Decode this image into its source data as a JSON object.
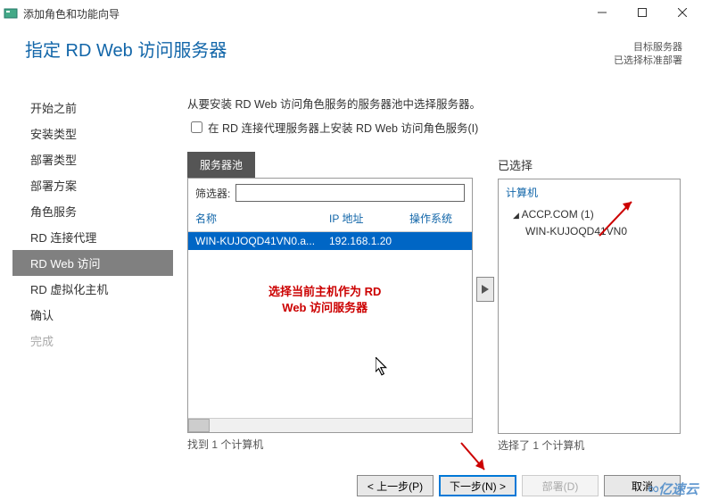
{
  "window": {
    "title": "添加角色和功能向导"
  },
  "header": {
    "title": "指定 RD Web 访问服务器",
    "status_label1": "目标服务器",
    "status_label2": "已选择标准部署"
  },
  "sidebar": {
    "items": [
      {
        "label": "开始之前",
        "type": "normal"
      },
      {
        "label": "安装类型",
        "type": "normal"
      },
      {
        "label": "部署类型",
        "type": "normal"
      },
      {
        "label": "部署方案",
        "type": "normal"
      },
      {
        "label": "角色服务",
        "type": "normal"
      },
      {
        "label": "RD 连接代理",
        "type": "normal"
      },
      {
        "label": "RD Web 访问",
        "type": "active"
      },
      {
        "label": "RD 虚拟化主机",
        "type": "normal"
      },
      {
        "label": "确认",
        "type": "normal"
      },
      {
        "label": "完成",
        "type": "disabled"
      }
    ]
  },
  "content": {
    "instruction": "从要安装 RD Web 访问角色服务的服务器池中选择服务器。",
    "checkbox_label": "在 RD 连接代理服务器上安装 RD Web 访问角色服务(I)",
    "checkbox_checked": false,
    "pool": {
      "tab": "服务器池",
      "filter_label": "筛选器:",
      "filter_value": "",
      "columns": {
        "name": "名称",
        "ip": "IP 地址",
        "os": "操作系统"
      },
      "rows": [
        {
          "name": "WIN-KUJOQD41VN0.a...",
          "ip": "192.168.1.20",
          "os": ""
        }
      ],
      "footer": "找到 1 个计算机"
    },
    "annotation": {
      "line1": "选择当前主机作为 RD",
      "line2": "Web 访问服务器"
    },
    "selected": {
      "title": "已选择",
      "head": "计算机",
      "nodes": [
        {
          "label": "ACCP.COM (1)",
          "children": [
            "WIN-KUJOQD41VN0"
          ]
        }
      ],
      "footer": "选择了 1 个计算机"
    }
  },
  "buttons": {
    "prev": "< 上一步(P)",
    "next": "下一步(N) >",
    "deploy": "部署(D)",
    "cancel": "取消"
  },
  "watermark": "亿速云"
}
